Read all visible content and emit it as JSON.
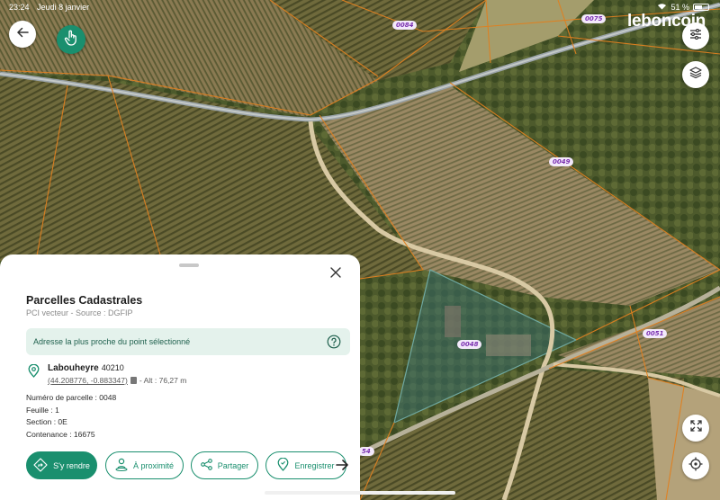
{
  "status_bar": {
    "time": "23:24",
    "date": "Jeudi 8 janvier",
    "battery": "51 %"
  },
  "brand": {
    "name": "leboncoin"
  },
  "colors": {
    "accent": "#1a8f6e",
    "parcel_label": "#7a2fb0",
    "parcel_border": "#e08020",
    "banner_bg": "#e4f2ec"
  },
  "map": {
    "parcels": [
      {
        "id": "0084"
      },
      {
        "id": "0075"
      },
      {
        "id": "0049"
      },
      {
        "id": "0048"
      },
      {
        "id": "0051"
      },
      {
        "id": "54"
      }
    ]
  },
  "controls": {
    "back_icon": "back-arrow-icon",
    "touch_icon": "hand-pointer-icon",
    "filters_icon": "sliders-icon",
    "layers_icon": "layers-icon",
    "expand_icon": "expand-icon",
    "locate_icon": "crosshair-icon"
  },
  "panel": {
    "title": "Parcelles Cadastrales",
    "subtitle": "PCI vecteur - Source : DGFIP",
    "address_banner": "Adresse la plus proche du point sélectionné",
    "city": "Labouheyre",
    "zip": "40210",
    "coordinates": "(44.208776, -0.883347)",
    "altitude": "- Alt : 76,27 m",
    "details": [
      "Numéro de parcelle : 0048",
      "Feuille : 1",
      "Section : 0E",
      "Contenance : 16675"
    ],
    "actions": [
      {
        "label": "S'y rendre",
        "icon": "directions-icon"
      },
      {
        "label": "À proximité",
        "icon": "person-pin-icon"
      },
      {
        "label": "Partager",
        "icon": "share-icon"
      },
      {
        "label": "Enregistrer",
        "icon": "bookmark-pin-icon"
      }
    ]
  }
}
